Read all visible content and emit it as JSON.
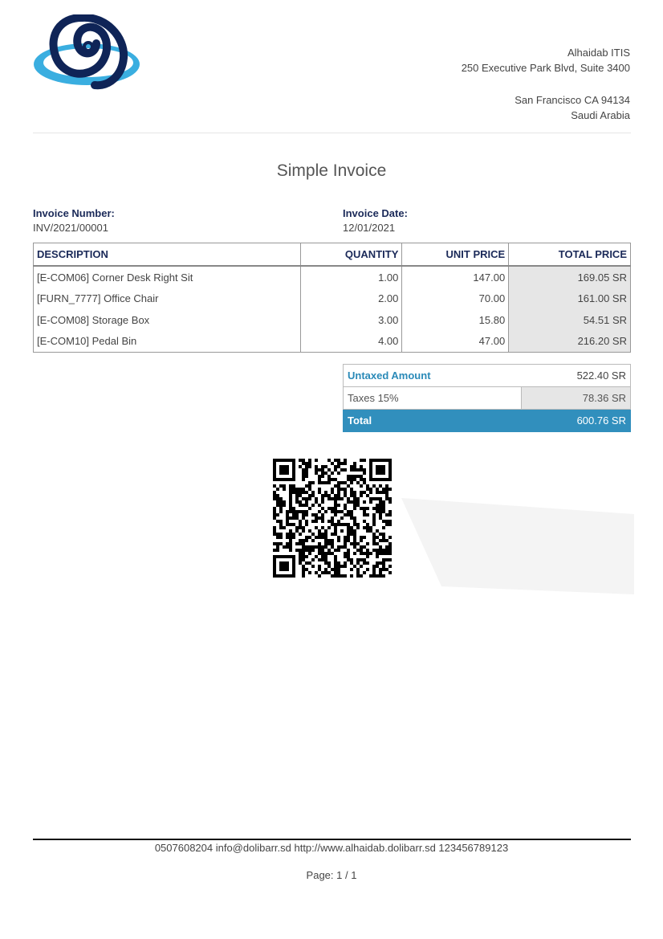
{
  "company": {
    "name": "Alhaidab ITIS",
    "street": "250 Executive Park Blvd, Suite 3400",
    "city": "San Francisco CA 94134",
    "country": "Saudi Arabia"
  },
  "logo": {
    "icon": "swirl-cloud-logo",
    "colors": [
      "#0f2457",
      "#3aaee0"
    ]
  },
  "title": "Simple Invoice",
  "invoice": {
    "number_label": "Invoice Number:",
    "number": "INV/2021/00001",
    "date_label": "Invoice Date:",
    "date": "12/01/2021"
  },
  "lines": {
    "headers": [
      "DESCRIPTION",
      "QUANTITY",
      "UNIT PRICE",
      "TOTAL PRICE"
    ],
    "rows": [
      {
        "description": "[E-COM06] Corner Desk Right Sit",
        "quantity": "1.00",
        "unit_price": "147.00",
        "total": "169.05 SR"
      },
      {
        "description": "[FURN_7777] Office Chair",
        "quantity": "2.00",
        "unit_price": "70.00",
        "total": "161.00 SR"
      },
      {
        "description": "[E-COM08] Storage Box",
        "quantity": "3.00",
        "unit_price": "15.80",
        "total": "54.51 SR"
      },
      {
        "description": "[E-COM10] Pedal Bin",
        "quantity": "4.00",
        "unit_price": "47.00",
        "total": "216.20 SR"
      }
    ]
  },
  "totals": {
    "untaxed_label": "Untaxed Amount",
    "untaxed_value": "522.40 SR",
    "tax_label": "Taxes 15%",
    "tax_value": "78.36 SR",
    "total_label": "Total",
    "total_value": "600.76 SR"
  },
  "qr": {
    "icon": "qr-code"
  },
  "footer": {
    "contact": "0507608204 info@dolibarr.sd http://www.alhaidab.dolibarr.sd 123456789123",
    "page": "Page: 1 / 1"
  },
  "colors": {
    "accent": "#318fbd",
    "heading": "#1b2a59",
    "shade": "#e6e6e6"
  }
}
